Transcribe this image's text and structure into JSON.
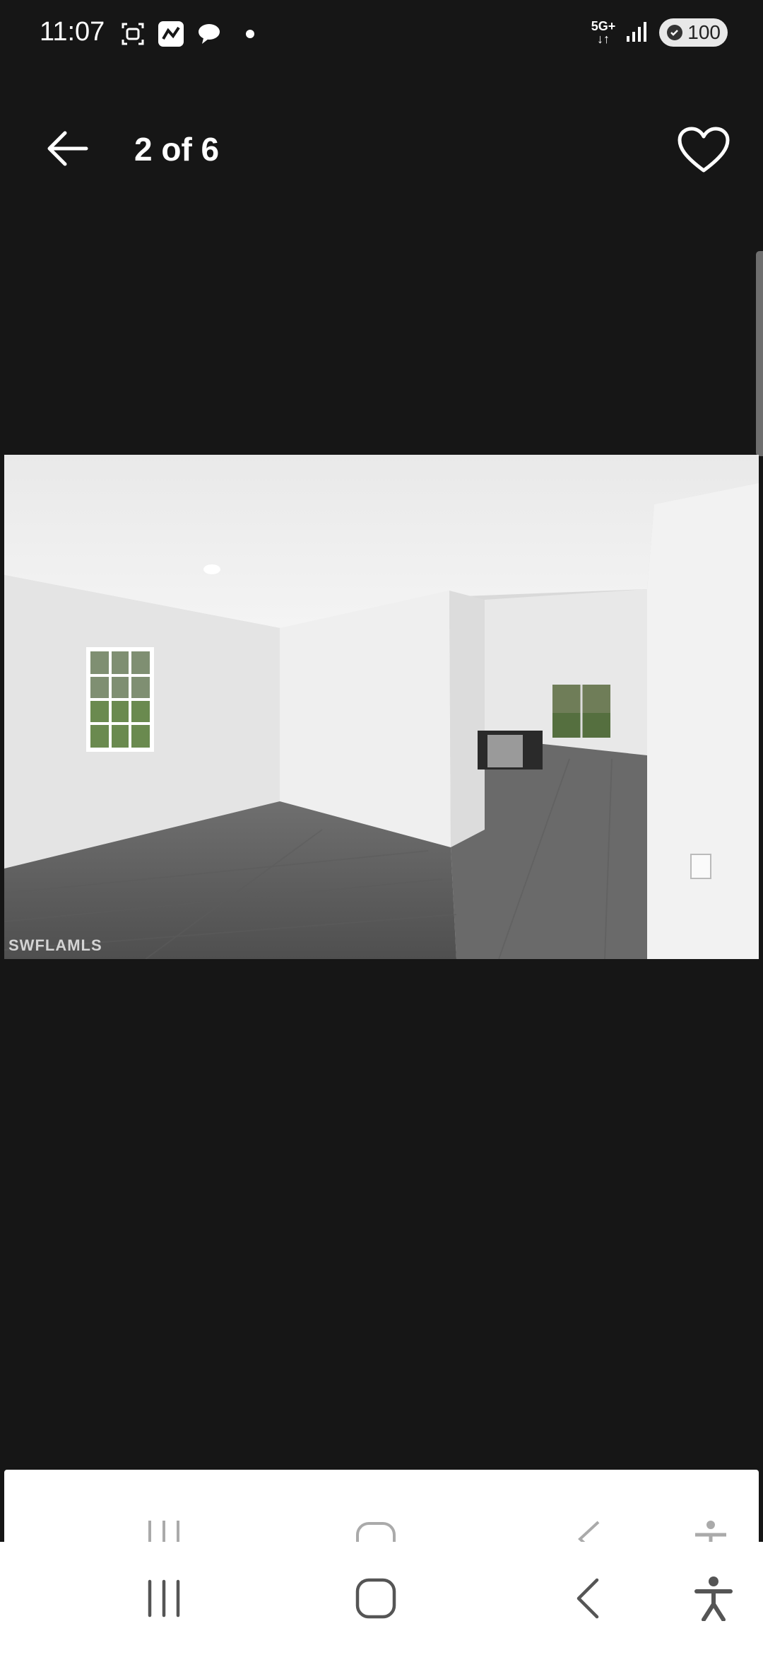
{
  "status_bar": {
    "time": "11:07",
    "network": "5G+",
    "battery": "100",
    "icons": [
      "screenshot-icon",
      "app-notification-icon",
      "chat-bubble-icon",
      "notification-dot",
      "signal-icon",
      "shield-icon"
    ]
  },
  "header": {
    "counter": "2 of 6",
    "back_icon": "arrow-left-icon",
    "favorite_icon": "heart-outline-icon"
  },
  "photo": {
    "description_name": "listing-photo",
    "watermark": "SWFLAMLS",
    "current_index": 2,
    "total": 6
  },
  "nav_bar": {
    "items": [
      "recent-apps-icon",
      "home-icon",
      "back-icon",
      "accessibility-icon"
    ]
  },
  "colors": {
    "background": "#161616",
    "nav_background": "#ffffff",
    "icon_dark": "#555555"
  }
}
